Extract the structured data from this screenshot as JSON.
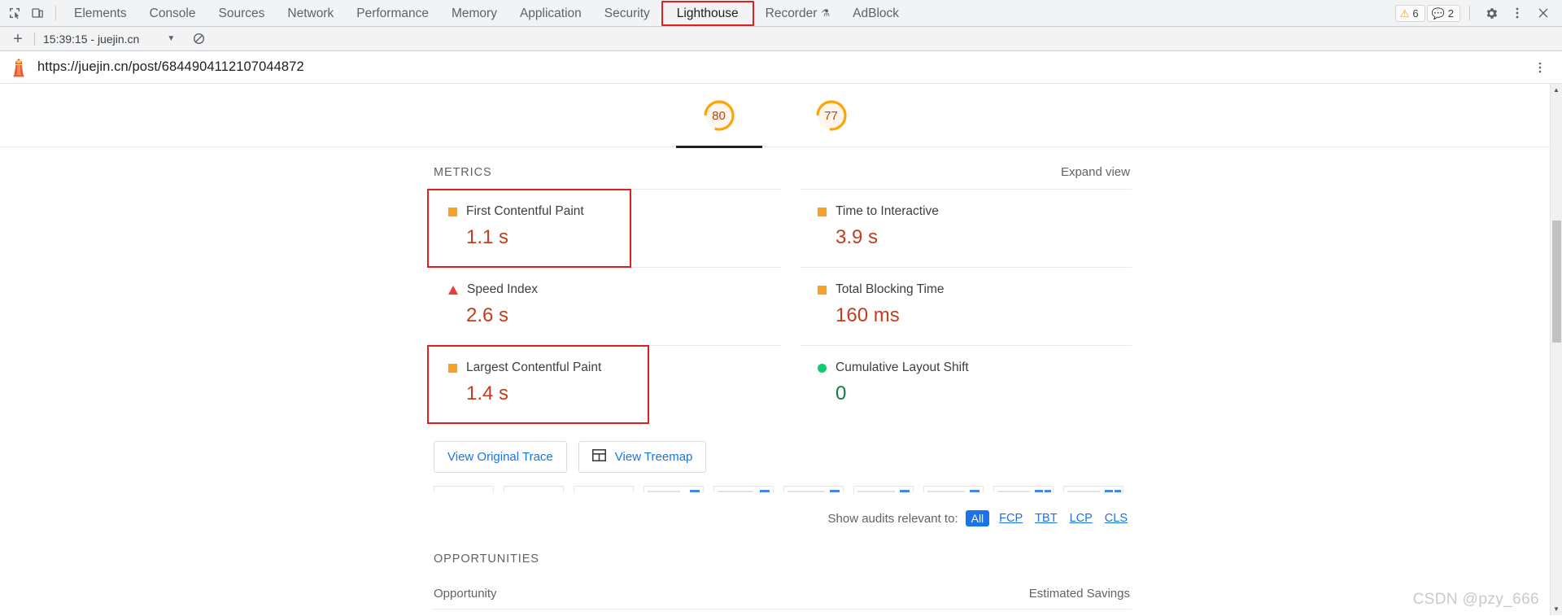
{
  "devtools": {
    "left_icons": [
      {
        "name": "inspect-element-icon"
      },
      {
        "name": "device-toolbar-icon"
      }
    ],
    "tabs": [
      {
        "label": "Elements",
        "selected": false
      },
      {
        "label": "Console",
        "selected": false
      },
      {
        "label": "Sources",
        "selected": false
      },
      {
        "label": "Network",
        "selected": false
      },
      {
        "label": "Performance",
        "selected": false
      },
      {
        "label": "Memory",
        "selected": false
      },
      {
        "label": "Application",
        "selected": false
      },
      {
        "label": "Security",
        "selected": false
      },
      {
        "label": "Lighthouse",
        "selected": true
      },
      {
        "label": "Recorder",
        "selected": false,
        "flask": "⚗"
      },
      {
        "label": "AdBlock",
        "selected": false
      }
    ],
    "badges": {
      "warnings": "6",
      "messages": "2"
    },
    "right_icons": [
      {
        "name": "settings-gear-icon"
      },
      {
        "name": "more-options-kebab-icon"
      },
      {
        "name": "close-devtools-icon"
      }
    ]
  },
  "lighthouse_toolbar": {
    "new_report_label": "+",
    "report_selector_value": "15:39:15 - juejin.cn",
    "caret": "▼",
    "clear_icon": "clear-all-icon"
  },
  "url_bar": {
    "logo": "lighthouse-logo-icon",
    "url": "https://juejin.cn/post/6844904112107044872",
    "kebab": "more-options-kebab-icon"
  },
  "gauges": [
    {
      "score": "80",
      "selected": true,
      "color": "#ffa400"
    },
    {
      "score": "77",
      "selected": false,
      "color": "#ffa400"
    }
  ],
  "metrics_section": {
    "title": "METRICS",
    "expand_label": "Expand view",
    "items": [
      {
        "label": "First Contentful Paint",
        "value": "1.1 s",
        "icon": "square",
        "rating": "average",
        "value_color": "#c33d1c",
        "annotated": true
      },
      {
        "label": "Time to Interactive",
        "value": "3.9 s",
        "icon": "square",
        "rating": "average",
        "value_color": "#c33d1c",
        "annotated": false
      },
      {
        "label": "Speed Index",
        "value": "2.6 s",
        "icon": "triangle",
        "rating": "fail",
        "value_color": "#c33d1c",
        "annotated": false
      },
      {
        "label": "Total Blocking Time",
        "value": "160 ms",
        "icon": "square",
        "rating": "average",
        "value_color": "#c33d1c",
        "annotated": false
      },
      {
        "label": "Largest Contentful Paint",
        "value": "1.4 s",
        "icon": "square",
        "rating": "average",
        "value_color": "#c33d1c",
        "annotated": true
      },
      {
        "label": "Cumulative Layout Shift",
        "value": "0",
        "icon": "circle",
        "rating": "pass",
        "value_color": "#0b8043",
        "annotated": false
      }
    ]
  },
  "buttons": {
    "view_original_trace": "View Original Trace",
    "view_treemap": "View Treemap",
    "treemap_icon": "treemap-icon"
  },
  "filmstrip": {
    "frame_count": 10
  },
  "audit_filter": {
    "label": "Show audits relevant to:",
    "options": [
      {
        "label": "All",
        "selected": true
      },
      {
        "label": "FCP",
        "selected": false
      },
      {
        "label": "TBT",
        "selected": false
      },
      {
        "label": "LCP",
        "selected": false
      },
      {
        "label": "CLS",
        "selected": false
      }
    ]
  },
  "opportunities": {
    "title": "OPPORTUNITIES",
    "col_opportunity": "Opportunity",
    "col_savings": "Estimated Savings"
  },
  "scrollbar": {
    "up_arrow": "▲",
    "down_arrow": "▼"
  },
  "watermark": "CSDN @pzy_666",
  "colors": {
    "accent_blue": "#1a73e8",
    "orange": "#fa9f28",
    "green": "#0cce6b",
    "red": "#f03a3a",
    "annotation_red": "#e02020"
  }
}
